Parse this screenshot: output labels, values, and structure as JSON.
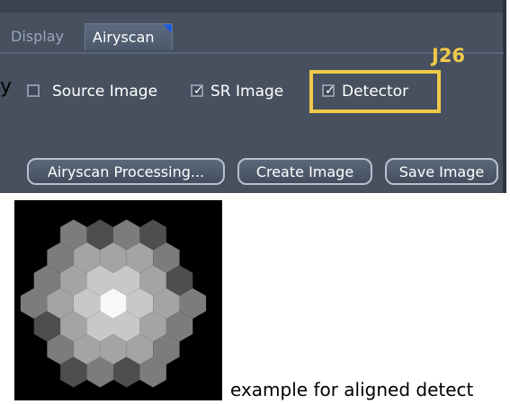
{
  "tabs": {
    "display_label": "Display",
    "airyscan_label": "Airyscan"
  },
  "options": [
    {
      "label": "Source Image",
      "checked": false
    },
    {
      "label": "SR Image",
      "checked": true
    },
    {
      "label": "Detector",
      "checked": true
    }
  ],
  "annotation": {
    "label": "J26",
    "color": "#f0c94a"
  },
  "buttons": {
    "processing": "Airyscan Processing...",
    "create": "Create Image",
    "save": "Save Image"
  },
  "figure": {
    "caption": "example for aligned detect"
  },
  "outside_text": "y",
  "colors": {
    "panel": "#46505f",
    "highlight": "#f0c94a",
    "tab_accent": "#1f5ad8"
  }
}
